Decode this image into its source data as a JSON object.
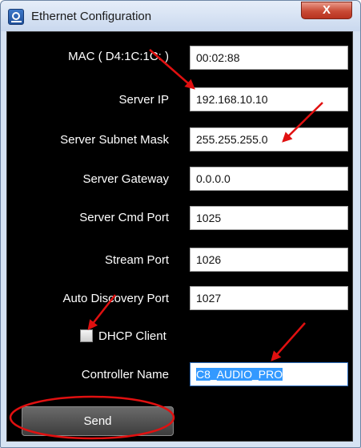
{
  "window": {
    "title": "Ethernet Configuration",
    "close_glyph": "X"
  },
  "form": {
    "fields": [
      {
        "label": "MAC ( D4:1C:1C: )",
        "value": "00:02:88"
      },
      {
        "label": "Server IP",
        "value": "192.168.10.10"
      },
      {
        "label": "Server Subnet Mask",
        "value": "255.255.255.0"
      },
      {
        "label": "Server Gateway",
        "value": "0.0.0.0"
      },
      {
        "label": "Server Cmd Port",
        "value": "1025"
      },
      {
        "label": "Stream Port",
        "value": "1026"
      },
      {
        "label": "Auto Discovery Port",
        "value": "1027"
      }
    ],
    "dhcp": {
      "label": "DHCP Client",
      "checked": false
    },
    "controller_name": {
      "label": "Controller Name",
      "value": "C8_AUDIO_PRO"
    },
    "send_label": "Send"
  },
  "annotations": {
    "color": "#e01010"
  }
}
